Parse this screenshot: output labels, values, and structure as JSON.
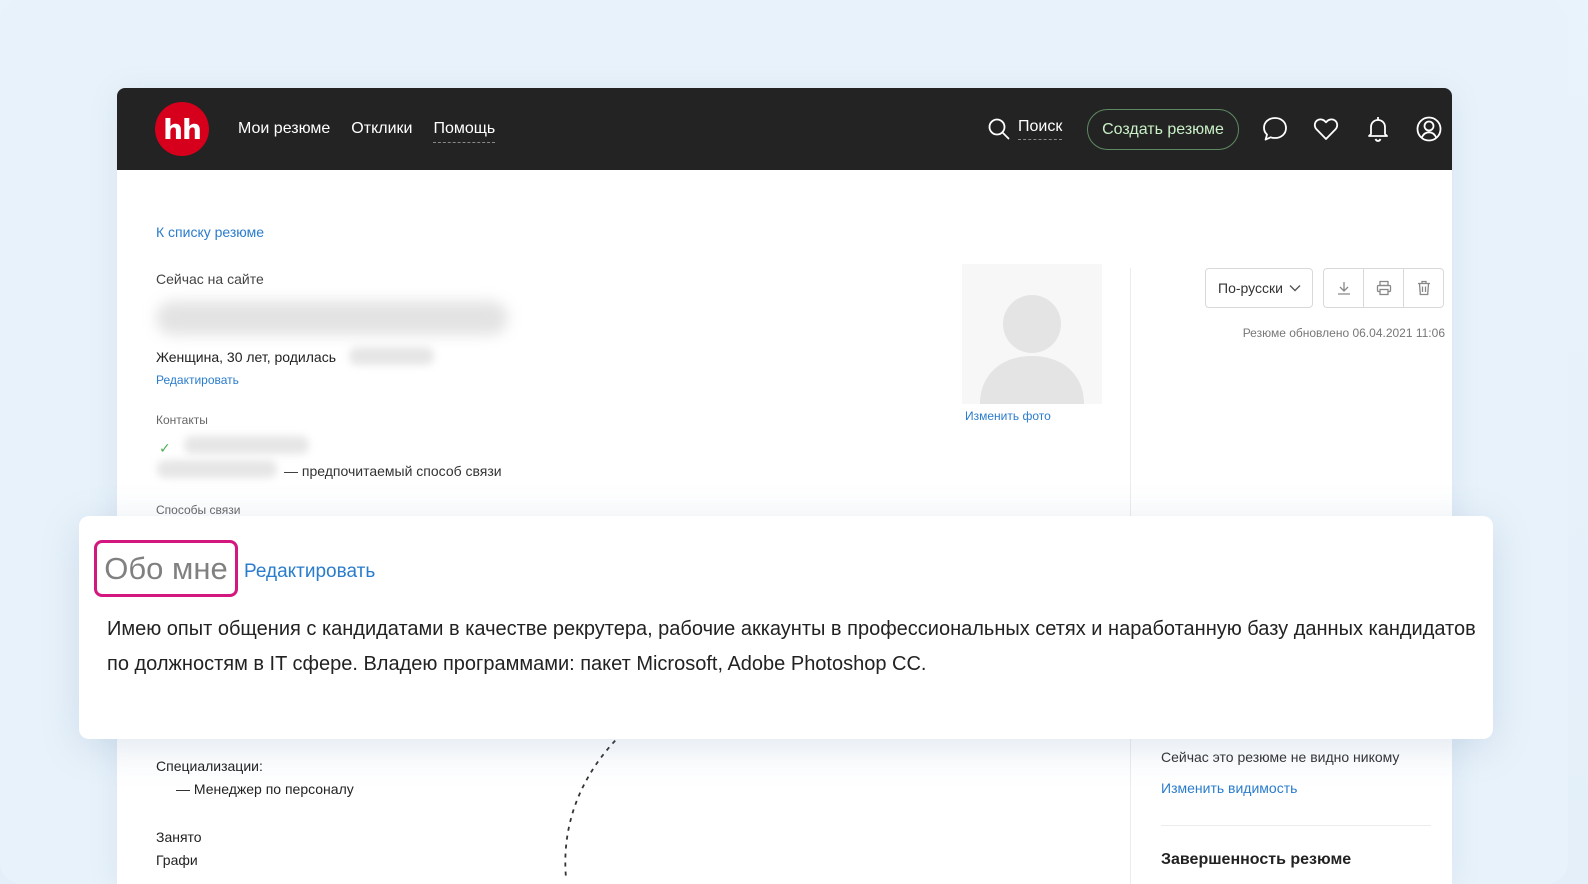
{
  "header": {
    "logo": "hh",
    "nav": [
      "Мои резюме",
      "Отклики",
      "Помощь"
    ],
    "search_label": "Поиск",
    "create_label": "Создать резюме",
    "icons": [
      "search-icon",
      "chat-icon",
      "heart-icon",
      "bell-icon",
      "user-icon"
    ]
  },
  "resume": {
    "back_link": "К списку резюме",
    "status": "Сейчас на сайте",
    "gender_age": "Женщина, 30 лет, родилась",
    "edit_label": "Редактировать",
    "contacts_label": "Контакты",
    "preferred_contact": "— предпочитаемый способ связи",
    "contact_ways_label": "Способы связи",
    "change_photo": "Изменить фото",
    "language": "По-русски",
    "updated": "Резюме обновлено 06.04.2021 11:06",
    "specializations_label": "Специализации:",
    "specialization": "— Менеджер по персоналу",
    "employment_label": "Занято",
    "schedule_label": "Графи"
  },
  "sidebar": {
    "visibility_text": "Сейчас это резюме не видно никому",
    "change_visibility": "Изменить видимость",
    "completeness_title": "Завершенность резюме"
  },
  "about": {
    "title": "Обо мне",
    "edit_label": "Редактировать",
    "text": "Имею опыт общения с кандидатами в качестве рекрутера, рабочие аккаунты в профессиональных сетях и наработанную базу данных кандидатов по должностям в IT сфере. Владею программами: пакет Microsoft, Adobe Photoshop CC."
  },
  "colors": {
    "brand": "#d6001c",
    "link": "#2a7ccc",
    "highlight": "#d4177e",
    "topbar": "#232323"
  }
}
